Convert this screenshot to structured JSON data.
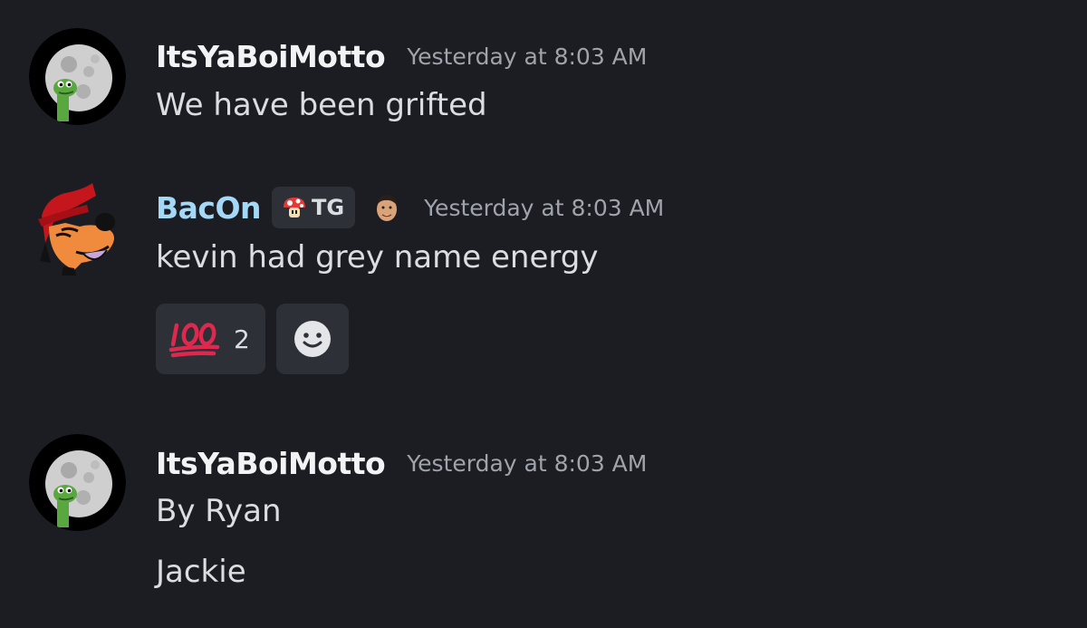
{
  "messages": [
    {
      "username": "ItsYaBoiMotto",
      "timestamp": "Yesterday at 8:03 AM",
      "lines": [
        "We have been grifted"
      ]
    },
    {
      "username": "BacOn",
      "tag": "TG",
      "timestamp": "Yesterday at 8:03 AM",
      "lines": [
        "kevin had grey name energy"
      ],
      "reactions": [
        {
          "emoji": "hundred-points",
          "count": "2"
        },
        {
          "emoji": "add-reaction-smiley"
        }
      ]
    },
    {
      "username": "ItsYaBoiMotto",
      "timestamp": "Yesterday at 8:03 AM",
      "lines": [
        "By Ryan",
        "Jackie"
      ]
    }
  ],
  "colors": {
    "background": "#1c1d22",
    "username_default": "#f2f3f5",
    "username_bacon": "#a3d8f7",
    "timestamp": "#9fa3ab",
    "reaction_bg": "#2e3038",
    "hundred_red": "#e0284f"
  }
}
